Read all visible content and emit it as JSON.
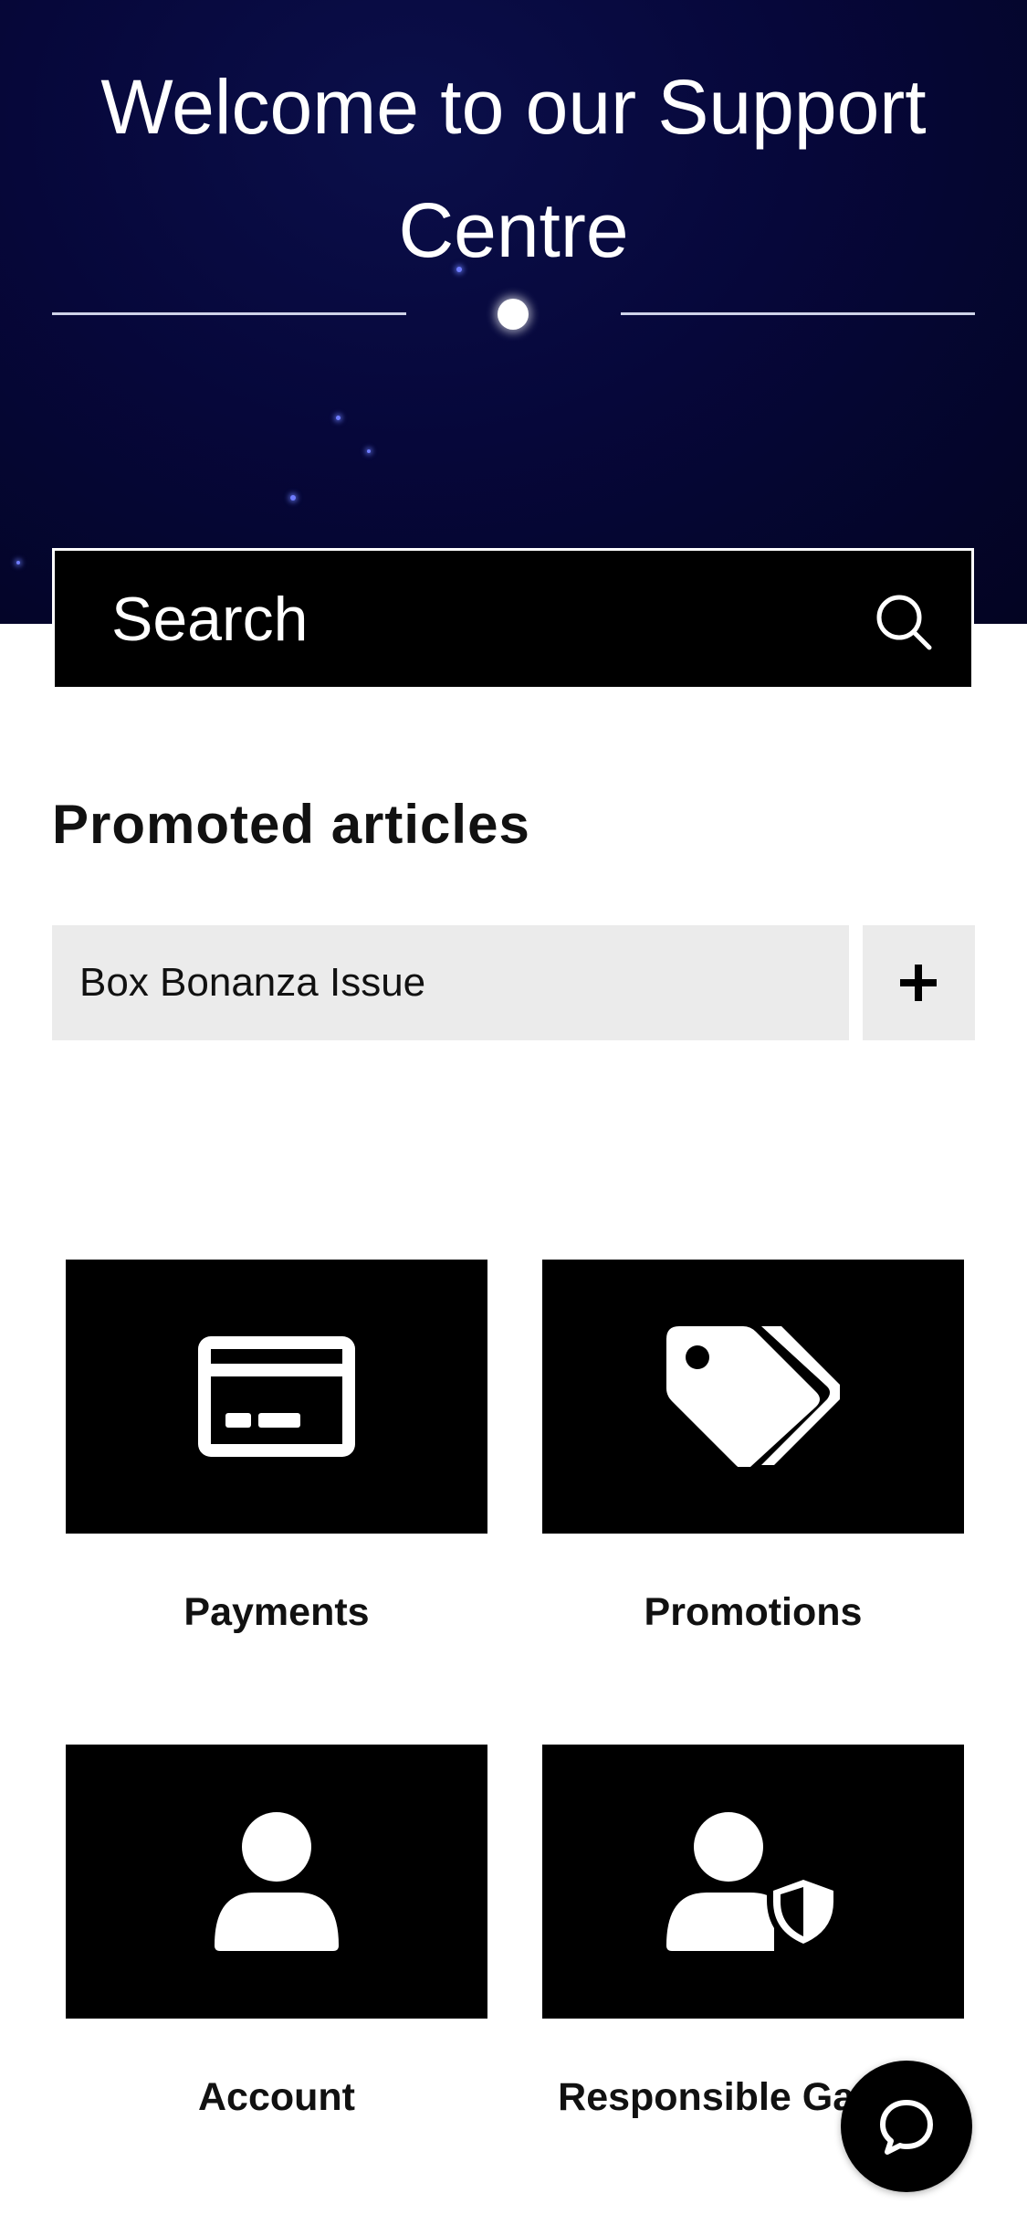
{
  "hero": {
    "title": "Welcome to our Support Centre"
  },
  "search": {
    "placeholder": "Search",
    "icon": "search-icon"
  },
  "promoted": {
    "title": "Promoted articles",
    "articles": [
      {
        "label": "Box Bonanza Issue",
        "expand_icon": "plus-icon"
      }
    ]
  },
  "categories": [
    {
      "label": "Payments",
      "icon": "credit-card-icon"
    },
    {
      "label": "Promotions",
      "icon": "tags-icon"
    },
    {
      "label": "Account",
      "icon": "user-icon"
    },
    {
      "label": "Responsible Gaming",
      "icon": "user-shield-icon"
    }
  ],
  "chat": {
    "icon": "chat-bubble-icon"
  },
  "colors": {
    "hero_background": "#06073a",
    "tile_background": "#000000",
    "article_background": "#ebebeb"
  }
}
